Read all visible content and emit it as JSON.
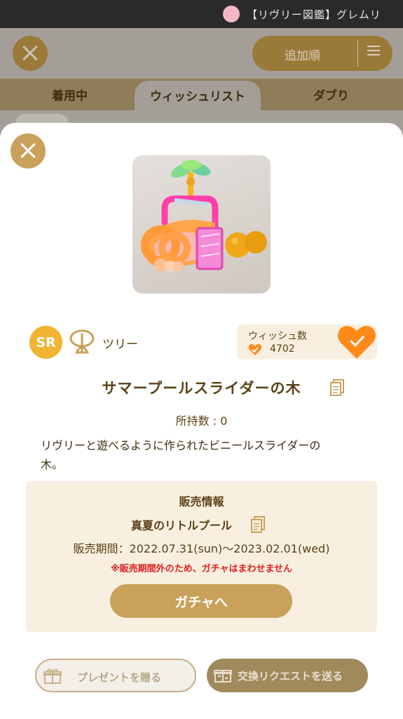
{
  "status_bar": {
    "title": "【リヴリー図鑑】グレムリ"
  },
  "background": {
    "sort_label": "追加順",
    "tabs": [
      "着用中",
      "ウィッシュリスト",
      "ダブり"
    ]
  },
  "item": {
    "rarity": "SR",
    "category": "ツリー",
    "wish_label": "ウィッシュ数",
    "wish_count": "4702",
    "name": "サマープールスライダーの木",
    "owned": "所持数 : 0",
    "description": "リヴリーと遊べるように作られたビニールスライダーの木。"
  },
  "sale_info": {
    "title": "販売情報",
    "gacha_name": "真夏のリトルプール",
    "period": "販売期間：2022.07.31(sun)〜2023.02.01(wed)",
    "warning": "※販売期間外のため、ガチャはまわせません",
    "gacha_button": "ガチャへ"
  },
  "actions": {
    "present_label": "プレゼントを贈る",
    "trade_label": "交換リクエストを送る"
  },
  "colors": {
    "accent": "#c9a15a",
    "rarity": "#f0b432",
    "heart": "#ff8a1a",
    "warning": "#e0201e",
    "panel": "#f8efe0"
  }
}
